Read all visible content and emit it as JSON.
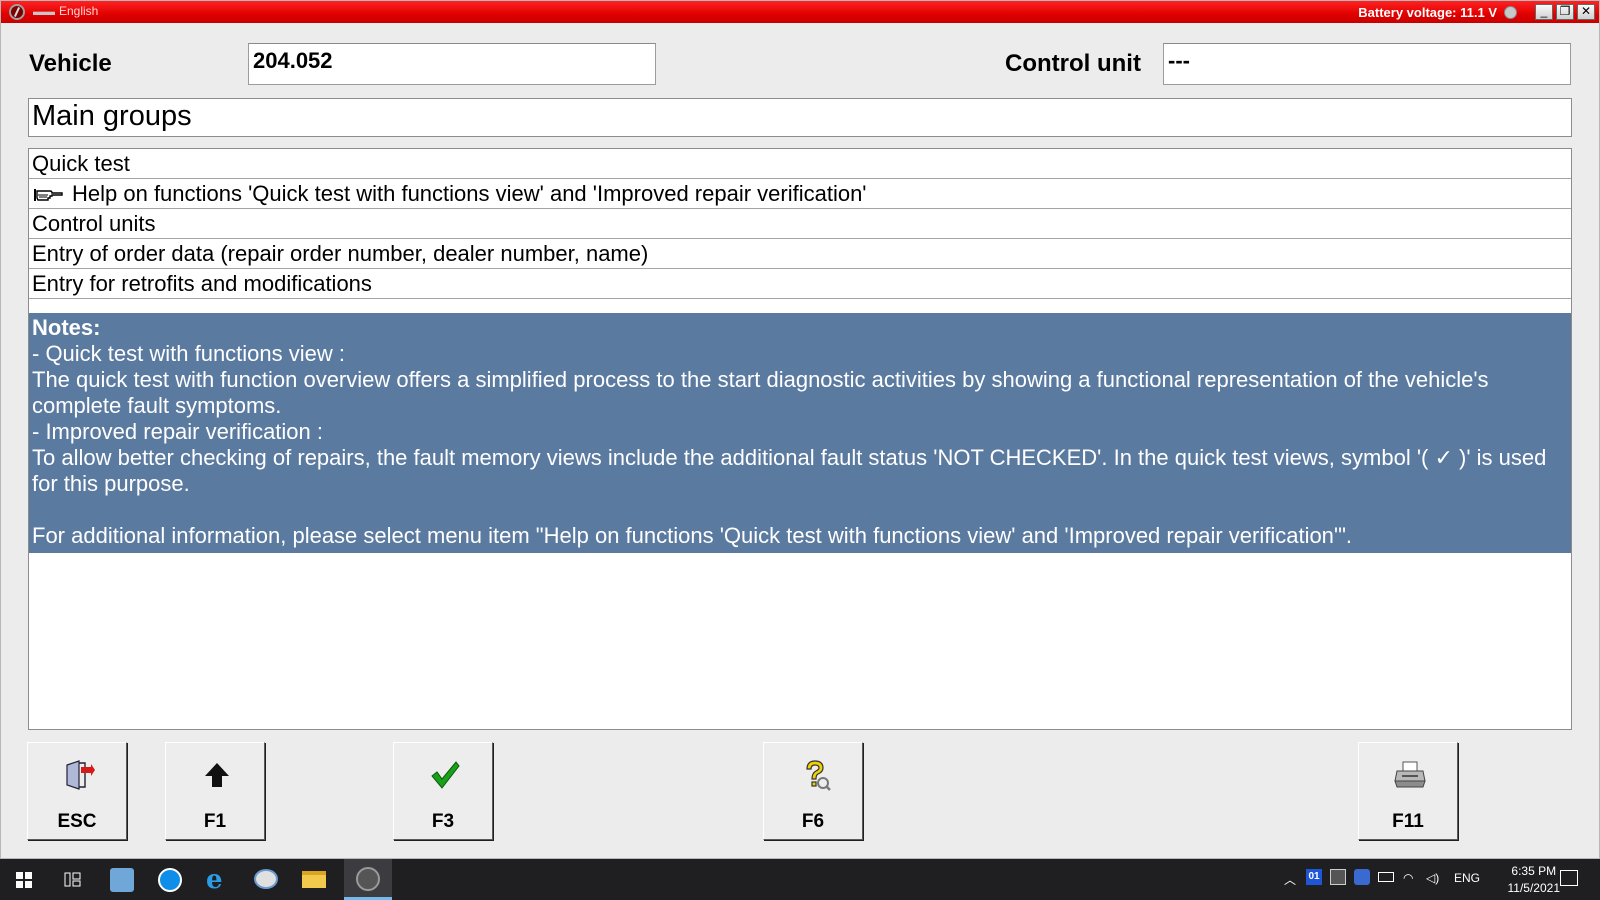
{
  "window": {
    "title_language": "English",
    "battery_label": "Battery voltage: 11.1 V",
    "controls": {
      "minimize": "_",
      "restore": "❐",
      "close": "✕"
    }
  },
  "header": {
    "vehicle_label": "Vehicle",
    "vehicle_value": "204.052",
    "control_unit_label": "Control unit",
    "control_unit_value": "---"
  },
  "section_title": "Main groups",
  "menu": [
    {
      "label": "Quick test",
      "icon": "none"
    },
    {
      "label": "Help on functions 'Quick test with functions view' and 'Improved repair verification'",
      "icon": "pointing-hand-icon"
    },
    {
      "label": "Control units",
      "icon": "none"
    },
    {
      "label": "Entry of order data (repair order number, dealer number, name)",
      "icon": "none"
    },
    {
      "label": "Entry for retrofits and modifications",
      "icon": "none"
    }
  ],
  "notes": {
    "heading": "Notes:",
    "line1": "- Quick test with functions view :",
    "line2": "The quick test with function overview offers a simplified process to the start diagnostic activities by showing a functional representation of the vehicle's complete fault symptoms.",
    "line3": "- Improved repair verification :",
    "line4": "To allow better checking of repairs, the fault memory views include the additional fault status 'NOT CHECKED'. In the quick test views, symbol '( ✓ )' is used for this purpose.",
    "line5": "For additional information, please select menu item \"Help on functions 'Quick test with functions view' and 'Improved repair verification'\"."
  },
  "function_keys": [
    {
      "key": "ESC",
      "icon": "exit-door-icon"
    },
    {
      "key": "F1",
      "icon": "up-arrow-icon"
    },
    {
      "key": "F3",
      "icon": "checkmark-icon"
    },
    {
      "key": "F6",
      "icon": "help-question-icon"
    },
    {
      "key": "F11",
      "icon": "printer-icon"
    }
  ],
  "taskbar": {
    "tray_text": "ENG",
    "time": "6:35 PM",
    "date": "11/5/2021"
  },
  "colors": {
    "titlebar": "#e00000",
    "notes_background": "#5b7aa0",
    "window_background": "#ececec"
  }
}
